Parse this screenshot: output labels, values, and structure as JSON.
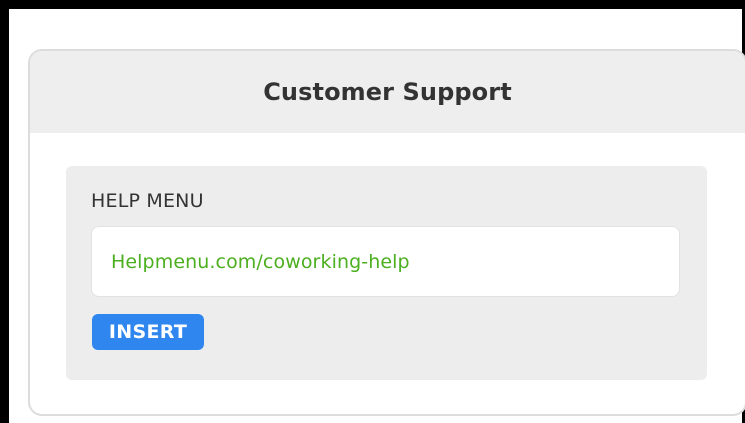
{
  "card": {
    "title": "Customer Support"
  },
  "help_menu": {
    "label": "HELP MENU",
    "url_value": "Helpmenu.com/coworking-help",
    "insert_label": "INSERT"
  },
  "colors": {
    "url_text": "#4caf1f",
    "button_bg": "#2f86ee",
    "header_bg": "#eeeeee",
    "panel_bg": "#ededed"
  }
}
